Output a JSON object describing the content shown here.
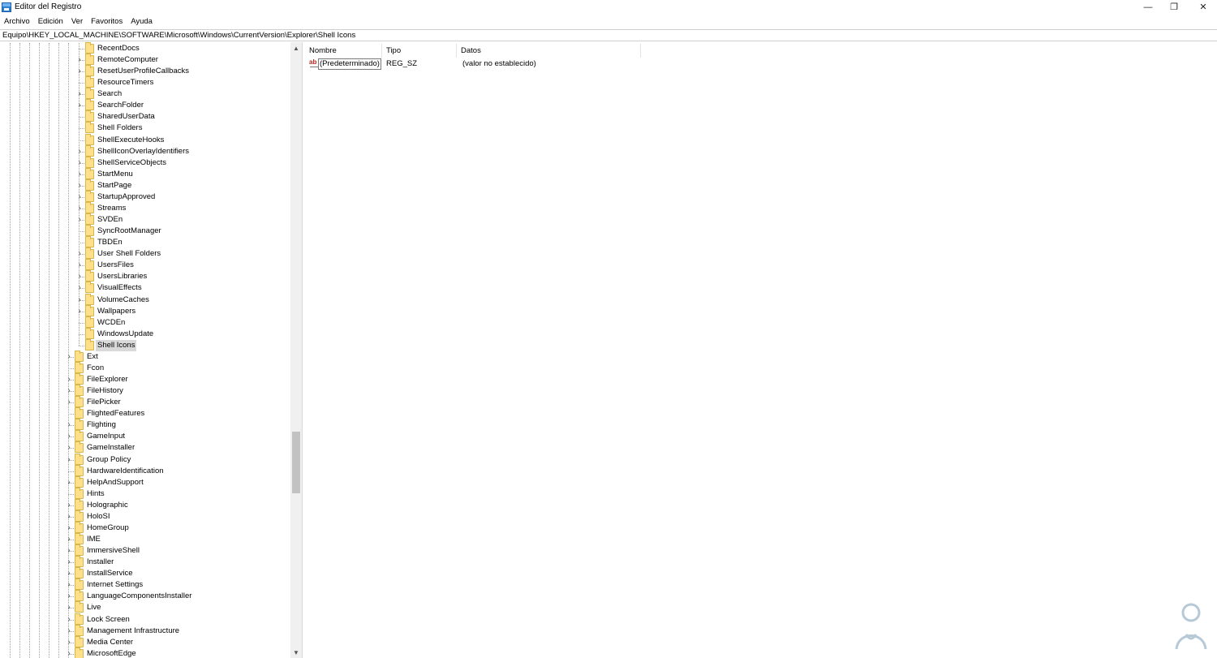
{
  "window": {
    "title": "Editor del Registro",
    "minimize_glyph": "—",
    "restore_glyph": "❐",
    "close_glyph": "✕"
  },
  "menu": [
    "Archivo",
    "Edición",
    "Ver",
    "Favoritos",
    "Ayuda"
  ],
  "address": "Equipo\\HKEY_LOCAL_MACHINE\\SOFTWARE\\Microsoft\\Windows\\CurrentVersion\\Explorer\\Shell Icons",
  "tree": {
    "items": [
      {
        "label": "RecentDocs",
        "level": 2,
        "expandable": false
      },
      {
        "label": "RemoteComputer",
        "level": 2,
        "expandable": true
      },
      {
        "label": "ResetUserProfileCallbacks",
        "level": 2,
        "expandable": true
      },
      {
        "label": "ResourceTimers",
        "level": 2,
        "expandable": false
      },
      {
        "label": "Search",
        "level": 2,
        "expandable": true
      },
      {
        "label": "SearchFolder",
        "level": 2,
        "expandable": true
      },
      {
        "label": "SharedUserData",
        "level": 2,
        "expandable": false
      },
      {
        "label": "Shell Folders",
        "level": 2,
        "expandable": false
      },
      {
        "label": "ShellExecuteHooks",
        "level": 2,
        "expandable": false
      },
      {
        "label": "ShellIconOverlayIdentifiers",
        "level": 2,
        "expandable": true
      },
      {
        "label": "ShellServiceObjects",
        "level": 2,
        "expandable": true
      },
      {
        "label": "StartMenu",
        "level": 2,
        "expandable": true
      },
      {
        "label": "StartPage",
        "level": 2,
        "expandable": true
      },
      {
        "label": "StartupApproved",
        "level": 2,
        "expandable": true
      },
      {
        "label": "Streams",
        "level": 2,
        "expandable": true
      },
      {
        "label": "SVDEn",
        "level": 2,
        "expandable": true
      },
      {
        "label": "SyncRootManager",
        "level": 2,
        "expandable": false
      },
      {
        "label": "TBDEn",
        "level": 2,
        "expandable": false
      },
      {
        "label": "User Shell Folders",
        "level": 2,
        "expandable": true
      },
      {
        "label": "UsersFiles",
        "level": 2,
        "expandable": true
      },
      {
        "label": "UsersLibraries",
        "level": 2,
        "expandable": true
      },
      {
        "label": "VisualEffects",
        "level": 2,
        "expandable": true
      },
      {
        "label": "VolumeCaches",
        "level": 2,
        "expandable": true
      },
      {
        "label": "Wallpapers",
        "level": 2,
        "expandable": true
      },
      {
        "label": "WCDEn",
        "level": 2,
        "expandable": false
      },
      {
        "label": "WindowsUpdate",
        "level": 2,
        "expandable": false
      },
      {
        "label": "Shell Icons",
        "level": 2,
        "expandable": false,
        "selected": true
      },
      {
        "label": "Ext",
        "level": 1,
        "expandable": true
      },
      {
        "label": "Fcon",
        "level": 1,
        "expandable": false
      },
      {
        "label": "FileExplorer",
        "level": 1,
        "expandable": true
      },
      {
        "label": "FileHistory",
        "level": 1,
        "expandable": true
      },
      {
        "label": "FilePicker",
        "level": 1,
        "expandable": true
      },
      {
        "label": "FlightedFeatures",
        "level": 1,
        "expandable": false
      },
      {
        "label": "Flighting",
        "level": 1,
        "expandable": true
      },
      {
        "label": "GameInput",
        "level": 1,
        "expandable": true
      },
      {
        "label": "GameInstaller",
        "level": 1,
        "expandable": true
      },
      {
        "label": "Group Policy",
        "level": 1,
        "expandable": true
      },
      {
        "label": "HardwareIdentification",
        "level": 1,
        "expandable": false
      },
      {
        "label": "HelpAndSupport",
        "level": 1,
        "expandable": true
      },
      {
        "label": "Hints",
        "level": 1,
        "expandable": false
      },
      {
        "label": "Holographic",
        "level": 1,
        "expandable": true
      },
      {
        "label": "HoloSI",
        "level": 1,
        "expandable": true
      },
      {
        "label": "HomeGroup",
        "level": 1,
        "expandable": true
      },
      {
        "label": "IME",
        "level": 1,
        "expandable": true
      },
      {
        "label": "ImmersiveShell",
        "level": 1,
        "expandable": true
      },
      {
        "label": "Installer",
        "level": 1,
        "expandable": true
      },
      {
        "label": "InstallService",
        "level": 1,
        "expandable": true
      },
      {
        "label": "Internet Settings",
        "level": 1,
        "expandable": true
      },
      {
        "label": "LanguageComponentsInstaller",
        "level": 1,
        "expandable": true
      },
      {
        "label": "Live",
        "level": 1,
        "expandable": true
      },
      {
        "label": "Lock Screen",
        "level": 1,
        "expandable": true
      },
      {
        "label": "Management Infrastructure",
        "level": 1,
        "expandable": true
      },
      {
        "label": "Media Center",
        "level": 1,
        "expandable": true
      },
      {
        "label": "MicrosoftEdge",
        "level": 1,
        "expandable": true
      }
    ]
  },
  "list": {
    "columns": {
      "name": "Nombre",
      "type": "Tipo",
      "data": "Datos"
    },
    "rows": [
      {
        "icon": "ab",
        "name": "(Predeterminado)",
        "type": "REG_SZ",
        "data": "(valor no establecido)"
      }
    ]
  },
  "colors": {
    "folder": "#ffe08a",
    "selection": "#d9d9d9",
    "watermark": "#b7c9d6"
  }
}
